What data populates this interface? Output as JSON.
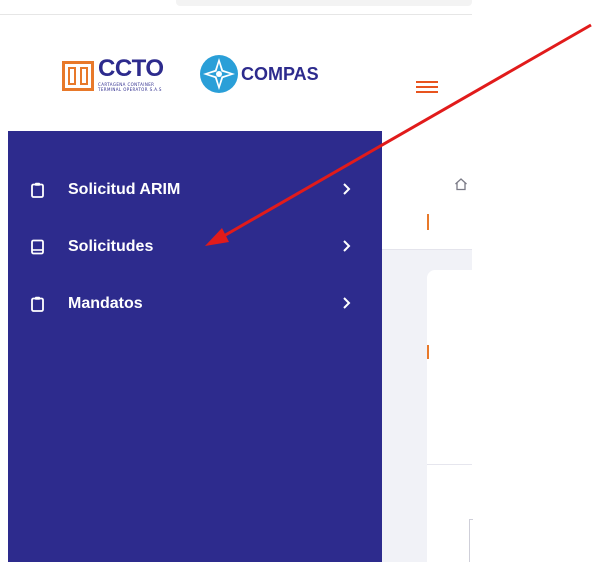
{
  "brand": {
    "ccto_name": "CCTO",
    "ccto_tagline_line1": "CARTAGENA CONTAINER",
    "ccto_tagline_line2": "TERMINAL OPERATOR S.A.S",
    "compas_name": "COMPAS",
    "accent_orange": "#e8792a",
    "brand_navy": "#2d2b8d",
    "compas_blue": "#2a9fd8"
  },
  "sidebar": {
    "background": "#2d2b8d",
    "items": [
      {
        "label": "Solicitud ARIM",
        "icon": "clipboard-icon"
      },
      {
        "label": "Solicitudes",
        "icon": "tablet-icon"
      },
      {
        "label": "Mandatos",
        "icon": "clipboard-icon"
      }
    ]
  },
  "annotation": {
    "arrow_color": "#e11b1b"
  }
}
